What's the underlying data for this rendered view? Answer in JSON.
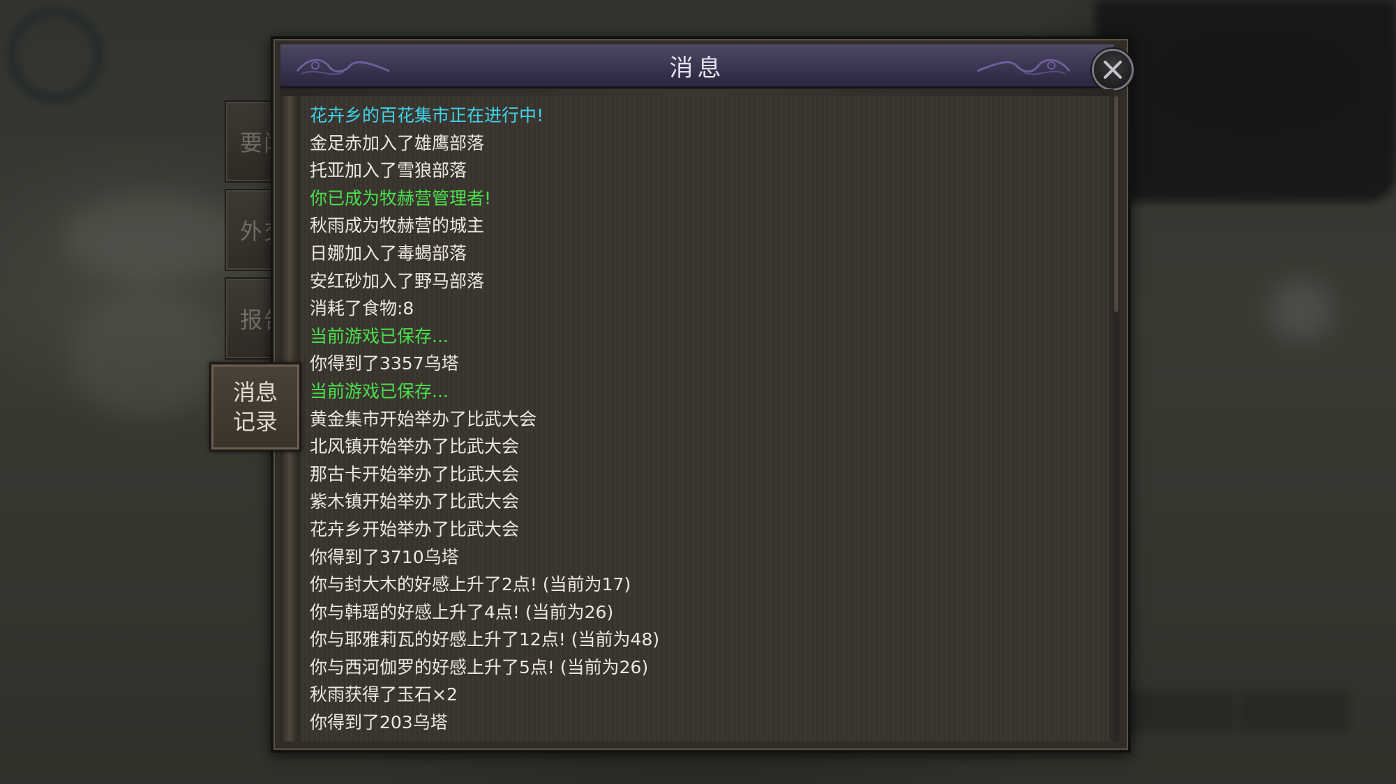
{
  "window": {
    "title": "消息"
  },
  "tabs": [
    {
      "label": "要闻"
    },
    {
      "label": "外交"
    },
    {
      "label": "报告"
    }
  ],
  "active_tab": {
    "line1": "消息",
    "line2": "记录"
  },
  "colors": {
    "white": "#ece8df",
    "cyan": "#3ed4ea",
    "green": "#49e04d"
  },
  "messages": [
    {
      "text": "花卉乡的百花集市正在进行中!",
      "color": "cyan"
    },
    {
      "text": "金足赤加入了雄鹰部落",
      "color": "white"
    },
    {
      "text": "托亚加入了雪狼部落",
      "color": "white"
    },
    {
      "text": "你已成为牧赫营管理者!",
      "color": "green"
    },
    {
      "text": "秋雨成为牧赫营的城主",
      "color": "white"
    },
    {
      "text": "日娜加入了毒蝎部落",
      "color": "white"
    },
    {
      "text": "安红砂加入了野马部落",
      "color": "white"
    },
    {
      "text": "消耗了食物:8",
      "color": "white"
    },
    {
      "text": "当前游戏已保存...",
      "color": "green"
    },
    {
      "text": "你得到了3357乌塔",
      "color": "white"
    },
    {
      "text": "当前游戏已保存...",
      "color": "green"
    },
    {
      "text": "黄金集市开始举办了比武大会",
      "color": "white"
    },
    {
      "text": "北风镇开始举办了比武大会",
      "color": "white"
    },
    {
      "text": "那古卡开始举办了比武大会",
      "color": "white"
    },
    {
      "text": "紫木镇开始举办了比武大会",
      "color": "white"
    },
    {
      "text": "花卉乡开始举办了比武大会",
      "color": "white"
    },
    {
      "text": "你得到了3710乌塔",
      "color": "white"
    },
    {
      "text": "你与封大木的好感上升了2点! (当前为17)",
      "color": "white"
    },
    {
      "text": "你与韩瑶的好感上升了4点! (当前为26)",
      "color": "white"
    },
    {
      "text": "你与耶雅莉瓦的好感上升了12点! (当前为48)",
      "color": "white"
    },
    {
      "text": "你与西河伽罗的好感上升了5点! (当前为26)",
      "color": "white"
    },
    {
      "text": "秋雨获得了玉石×2",
      "color": "white"
    },
    {
      "text": "你得到了203乌塔",
      "color": "white"
    }
  ],
  "icons": {
    "close": "close-icon"
  }
}
